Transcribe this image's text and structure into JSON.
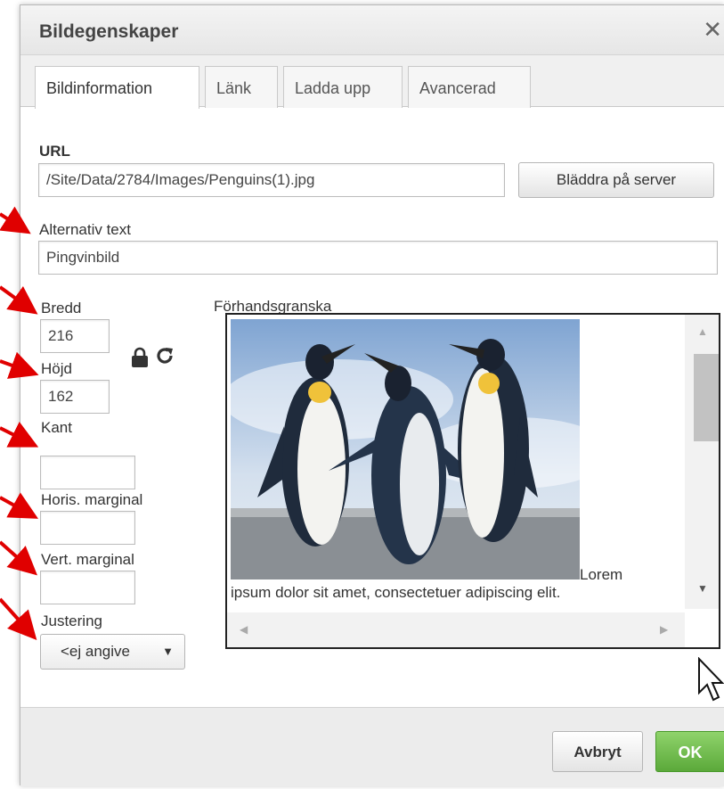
{
  "dialog": {
    "title": "Bildegenskaper",
    "close_symbol": "✕"
  },
  "tabs": [
    {
      "label": "Bildinformation",
      "active": true
    },
    {
      "label": "Länk",
      "active": false
    },
    {
      "label": "Ladda upp",
      "active": false
    },
    {
      "label": "Avancerad",
      "active": false
    }
  ],
  "fields": {
    "url_label": "URL",
    "url_value": "/Site/Data/2784/Images/Penguins(1).jpg",
    "browse_label": "Bläddra på server",
    "alt_label": "Alternativ text",
    "alt_value": "Pingvinbild",
    "width_label": "Bredd",
    "width_value": "216",
    "height_label": "Höjd",
    "height_value": "162",
    "border_label": "Kant",
    "border_value": "",
    "hspace_label": "Horis. marginal",
    "hspace_value": "",
    "vspace_label": "Vert. marginal",
    "vspace_value": "",
    "align_label": "Justering",
    "align_value": "<ej angive"
  },
  "preview": {
    "label": "Förhandsgranska",
    "text_line1": "Lorem",
    "text_line2": "ipsum dolor sit amet, consectetuer adipiscing elit."
  },
  "footer": {
    "cancel_label": "Avbryt",
    "ok_label": "OK"
  },
  "icons": [
    "close-icon",
    "lock-icon",
    "reset-size-icon",
    "dropdown-caret-icon",
    "mouse-cursor-icon"
  ],
  "colors": {
    "ok_button": "#5ba93a",
    "annotation_arrows": "#e00000"
  }
}
